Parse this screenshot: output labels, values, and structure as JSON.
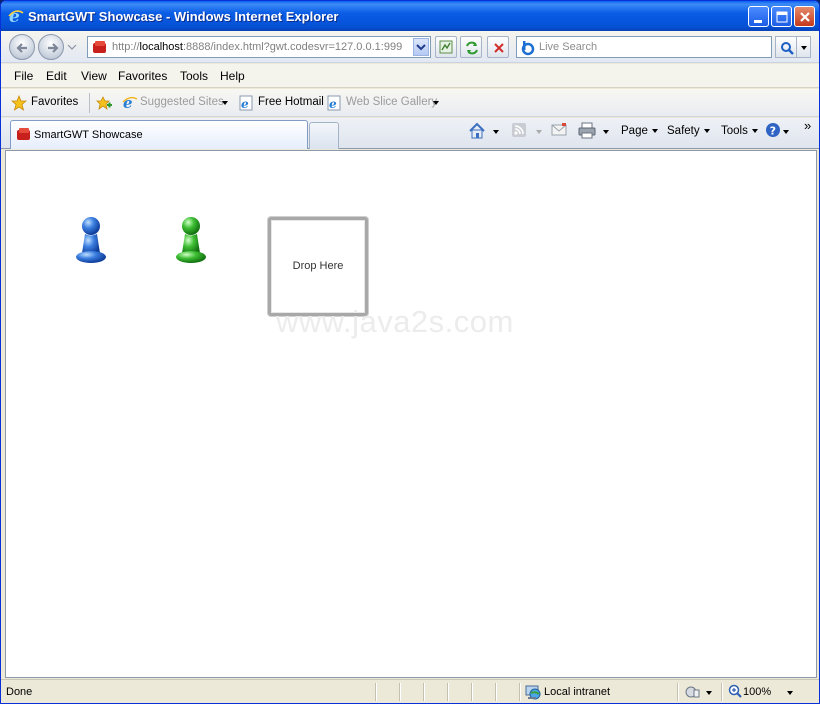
{
  "window": {
    "title": "SmartGWT Showcase - Windows Internet Explorer"
  },
  "address": {
    "url_prefix": "http://",
    "url_host": "localhost",
    "url_rest": ":8888/index.html?gwt.codesvr=127.0.0.1:999"
  },
  "search": {
    "placeholder": "Live Search"
  },
  "menu": {
    "items": [
      "File",
      "Edit",
      "View",
      "Favorites",
      "Tools",
      "Help"
    ]
  },
  "favorites_bar": {
    "favorites_label": "Favorites",
    "suggested_sites": "Suggested Sites",
    "free_hotmail": "Free Hotmail",
    "web_slice_gallery": "Web Slice Gallery"
  },
  "tabs": {
    "active_label": "SmartGWT Showcase"
  },
  "command_bar": {
    "page": "Page",
    "safety": "Safety",
    "tools": "Tools",
    "overflow": "»"
  },
  "content": {
    "drop_label": "Drop Here",
    "watermark": "www.java2s.com",
    "pawn_colors": {
      "blue": "#1f5fc9",
      "green": "#2fa52a"
    }
  },
  "status": {
    "text": "Done",
    "zone": "Local intranet",
    "zoom": "100%"
  },
  "icons": [
    "ie-logo-icon",
    "minimize-icon",
    "maximize-icon",
    "close-icon",
    "back-icon",
    "forward-icon",
    "page-icon",
    "compatibility-icon",
    "refresh-icon",
    "stop-icon",
    "search-icon",
    "star-icon",
    "add-favorites-icon",
    "ie-page-icon",
    "home-icon",
    "rss-icon",
    "mail-icon",
    "print-icon",
    "help-icon",
    "globe-icon",
    "protected-mode-icon",
    "zoom-icon"
  ]
}
